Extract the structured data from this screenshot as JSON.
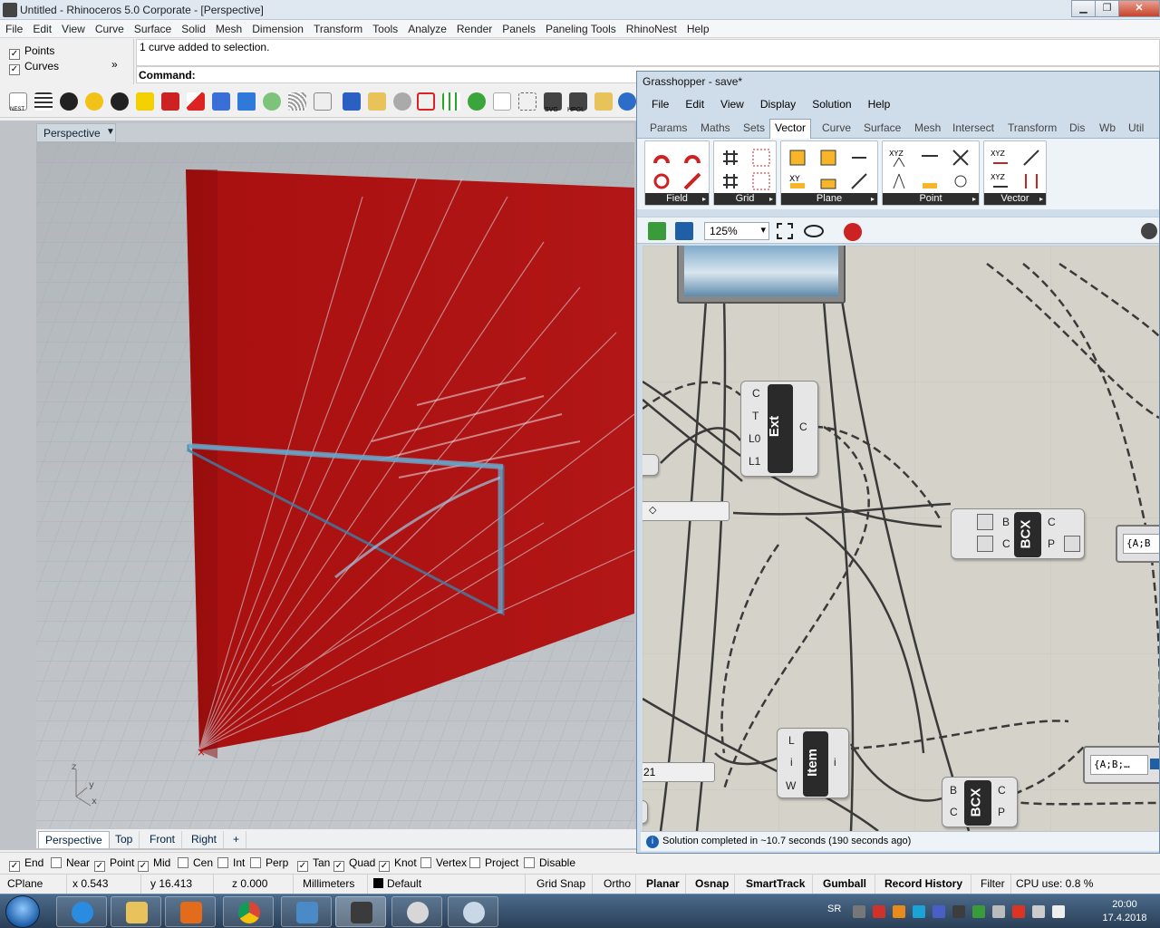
{
  "rhino": {
    "title": "Untitled - Rhinoceros  5.0 Corporate - [Perspective]",
    "menu": [
      "File",
      "Edit",
      "View",
      "Curve",
      "Surface",
      "Solid",
      "Mesh",
      "Dimension",
      "Transform",
      "Tools",
      "Analyze",
      "Render",
      "Panels",
      "Paneling Tools",
      "RhinoNest",
      "Help"
    ],
    "selection_filter": {
      "points_label": "Points",
      "curves_label": "Curves",
      "more_label": "»"
    },
    "command_history": "1 curve added to selection.",
    "command_prompt": "Command:",
    "toolbar": {
      "nest_label": "NEST",
      "svg_label": "SVG",
      "hpgl_label": "HPGL"
    },
    "viewport": {
      "label": "Perspective",
      "axis_labels": {
        "z": "z",
        "y": "y",
        "x": "x"
      },
      "tabs": [
        "Perspective",
        "Top",
        "Front",
        "Right"
      ],
      "add_tab": "+"
    },
    "osnaps": [
      {
        "label": "End",
        "checked": true
      },
      {
        "label": "Near",
        "checked": false
      },
      {
        "label": "Point",
        "checked": true
      },
      {
        "label": "Mid",
        "checked": true
      },
      {
        "label": "Cen",
        "checked": false
      },
      {
        "label": "Int",
        "checked": false
      },
      {
        "label": "Perp",
        "checked": false
      },
      {
        "label": "Tan",
        "checked": true
      },
      {
        "label": "Quad",
        "checked": true
      },
      {
        "label": "Knot",
        "checked": true
      },
      {
        "label": "Vertex",
        "checked": false
      },
      {
        "label": "Project",
        "checked": false
      },
      {
        "label": "Disable",
        "checked": false
      }
    ],
    "status": {
      "cplane": "CPlane",
      "x": "x 0.543",
      "y": "y 16.413",
      "z": "z 0.000",
      "units": "Millimeters",
      "layer": "Default",
      "grid_snap": "Grid Snap",
      "ortho": "Ortho",
      "planar": "Planar",
      "osnap": "Osnap",
      "smarttrack": "SmartTrack",
      "gumball": "Gumball",
      "record_history": "Record History",
      "filter": "Filter",
      "cpu": "CPU use: 0.8 %"
    }
  },
  "grasshopper": {
    "title": "Grasshopper - save*",
    "menu": [
      "File",
      "Edit",
      "View",
      "Display",
      "Solution",
      "Help"
    ],
    "tabs": [
      "Params",
      "Maths",
      "Sets",
      "Vector",
      "Curve",
      "Surface",
      "Mesh",
      "Intersect",
      "Transform",
      "Dis",
      "Wb",
      "Util"
    ],
    "active_tab": "Vector",
    "ribbon_groups": [
      "Field",
      "Grid",
      "Plane",
      "Point",
      "Vector"
    ],
    "ribbon_icon_labels": {
      "xyz": "XYZ",
      "xy": "XY"
    },
    "zoom": "125%",
    "components": {
      "ext": {
        "name": "Ext",
        "inputs": [
          "C",
          "T",
          "L0",
          "L1"
        ],
        "output": "C"
      },
      "bcx1": {
        "name": "BCX",
        "inputs": [
          "B",
          "C"
        ],
        "outputs": [
          "C",
          "P"
        ]
      },
      "item": {
        "name": "Item",
        "inputs": [
          "L",
          "i",
          "W"
        ],
        "output": "i"
      },
      "bcx2": {
        "name": "BCX",
        "inputs": [
          "B",
          "C"
        ],
        "outputs": [
          "C",
          "P"
        ]
      },
      "panel1": "{A;B",
      "panel2": "{A;B;…",
      "slider_value": "21"
    },
    "status": "Solution completed in ~10.7 seconds (190 seconds ago)"
  },
  "taskbar": {
    "lang": "SR",
    "time": "20:00",
    "date": "17.4.2018"
  },
  "colors": {
    "rhino_surface": "#a60d0d",
    "viewport_bg": "#b8bcc0",
    "gh_canvas": "#d5d2c9"
  }
}
